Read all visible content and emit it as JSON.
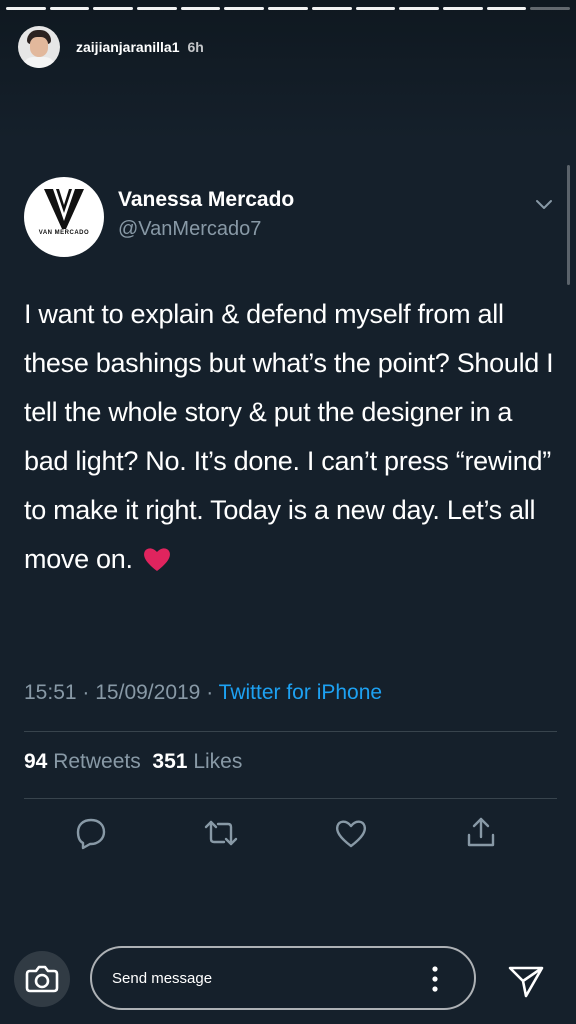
{
  "progress": {
    "total_segments": 13,
    "completed_segments": 12
  },
  "story": {
    "username": "zaijianjaranilla1",
    "time_ago": "6h"
  },
  "tweet": {
    "avatar_logo_text": "VAN MERCADO",
    "display_name": "Vanessa Mercado",
    "handle": "@VanMercado7",
    "text": "I want to explain & defend myself from all these bashings but what’s the point? Should I tell the whole story & put the designer in a bad light? No. It’s done. I can’t press “rewind” to make it right. Today is a new day. Let’s all move on.",
    "emoji": "red-heart",
    "time": "15:51",
    "date": "15/09/2019",
    "separator": "·",
    "source": "Twitter for iPhone",
    "retweets_count": "94",
    "retweets_label": "Retweets",
    "likes_count": "351",
    "likes_label": "Likes",
    "actions": [
      "reply-icon",
      "retweet-icon",
      "like-icon",
      "share-icon"
    ]
  },
  "message_bar": {
    "placeholder": "Send message"
  },
  "colors": {
    "background": "#15202b",
    "secondary_text": "#8899a6",
    "link": "#1da1f2",
    "divider": "#38444d",
    "heart": "#e0245e"
  }
}
